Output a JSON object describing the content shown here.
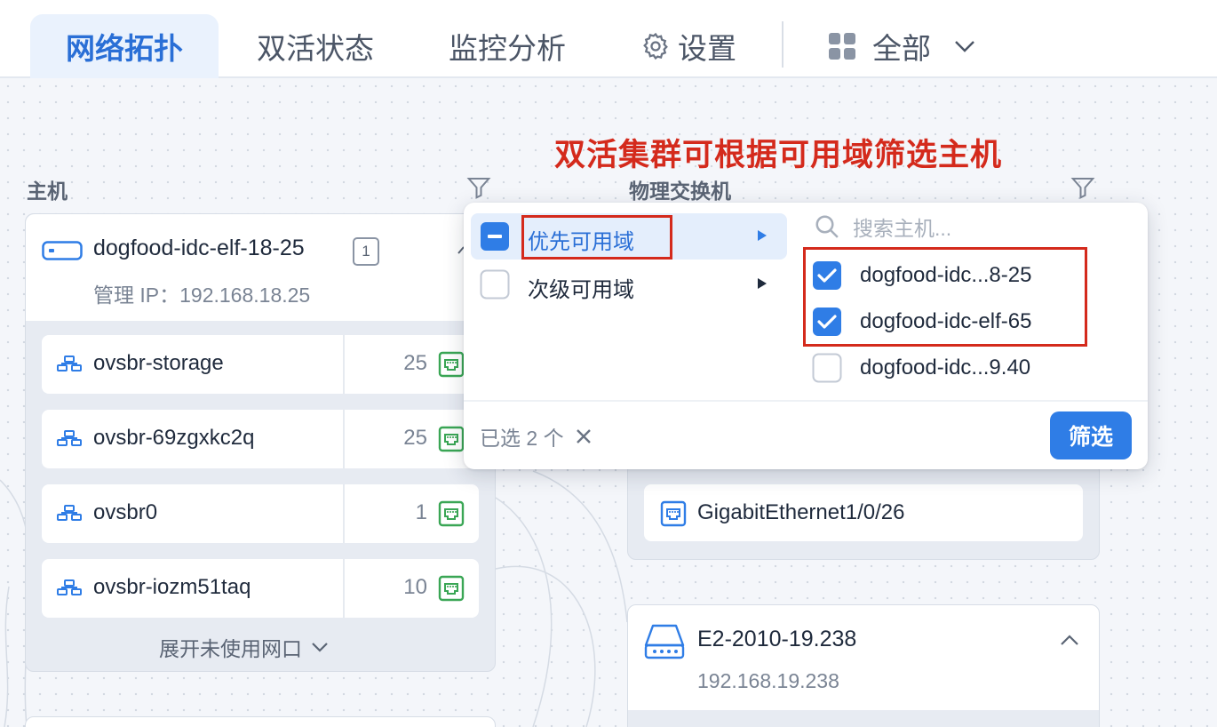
{
  "tabs": [
    {
      "label": "网络拓扑",
      "active": true
    },
    {
      "label": "双活状态"
    },
    {
      "label": "监控分析"
    },
    {
      "label": "设置",
      "icon": "gear-icon"
    },
    {
      "label": "全部",
      "icon": "grid-icon"
    }
  ],
  "annotation": "双活集群可根据可用域筛选主机",
  "sections": {
    "hosts_label": "主机",
    "switches_label": "物理交换机"
  },
  "host": {
    "name": "dogfood-idc-elf-18-25",
    "badge": "1",
    "ip": "管理 IP：192.168.18.25",
    "ports": [
      {
        "name": "ovsbr-storage",
        "count": "25"
      },
      {
        "name": "ovsbr-69zgxkc2q",
        "count": "25"
      },
      {
        "name": "ovsbr0",
        "count": "1"
      },
      {
        "name": "ovsbr-iozm51taq",
        "count": "10"
      }
    ],
    "expand_label": "展开未使用网口"
  },
  "switch_port": {
    "name": "GigabitEthernet1/0/26"
  },
  "switch": {
    "name": "E2-2010-19.238",
    "ip": "192.168.19.238"
  },
  "popup": {
    "menu": [
      {
        "label": "优先可用域",
        "state": "indeterminate"
      },
      {
        "label": "次级可用域",
        "state": "unchecked"
      }
    ],
    "search_placeholder": "搜索主机...",
    "options": [
      {
        "label": "dogfood-idc...8-25",
        "checked": true
      },
      {
        "label": "dogfood-idc-elf-65",
        "checked": true
      },
      {
        "label": "dogfood-idc...9.40",
        "checked": false
      }
    ],
    "selected_text": "已选 2 个",
    "filter_button": "筛选"
  },
  "colors": {
    "accent": "#2f7de6",
    "annotation_red": "#d42a1c",
    "active_tab_bg": "#eaf2fd",
    "port_green": "#3aa655"
  }
}
